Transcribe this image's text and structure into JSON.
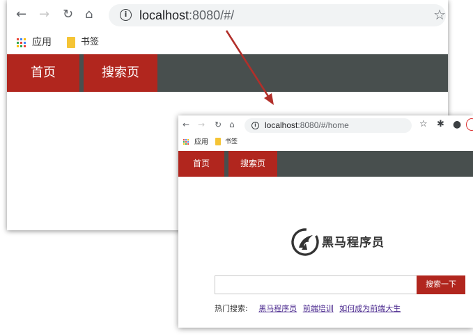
{
  "window1": {
    "url_host": "localhost",
    "url_rest": ":8080/#/",
    "bookmarks": {
      "apps_label": "应用",
      "bookmarks_label": "书签"
    },
    "nav": {
      "home": "首页",
      "search": "搜索页"
    },
    "icons": [
      "back-icon",
      "forward-icon",
      "reload-icon",
      "home-icon",
      "info-icon",
      "star-icon",
      "apps-icon",
      "folder-icon"
    ]
  },
  "window2": {
    "url_host": "localhost",
    "url_rest": ":8080/#/home",
    "bookmarks": {
      "apps_label": "应用",
      "bookmarks_label": "书签"
    },
    "nav": {
      "home": "首页",
      "search": "搜索页"
    },
    "logo_text": "黑马程序员",
    "search": {
      "value": "",
      "placeholder": "",
      "button_label": "搜索一下"
    },
    "hot_search": {
      "label": "热门搜索:",
      "links": [
        "黑马程序员",
        "前端培训",
        "如何成为前端大生"
      ]
    },
    "icons": [
      "back-icon",
      "forward-icon",
      "reload-icon",
      "home-icon",
      "info-icon",
      "star-icon",
      "extension-icon",
      "profile-icon",
      "logo-icon"
    ]
  },
  "colors": {
    "nav_active": "#b1261e",
    "nav_bar": "#484f4e",
    "arrow": "#b22f2a",
    "link": "#4b2a8f",
    "folder": "#f5c435"
  }
}
